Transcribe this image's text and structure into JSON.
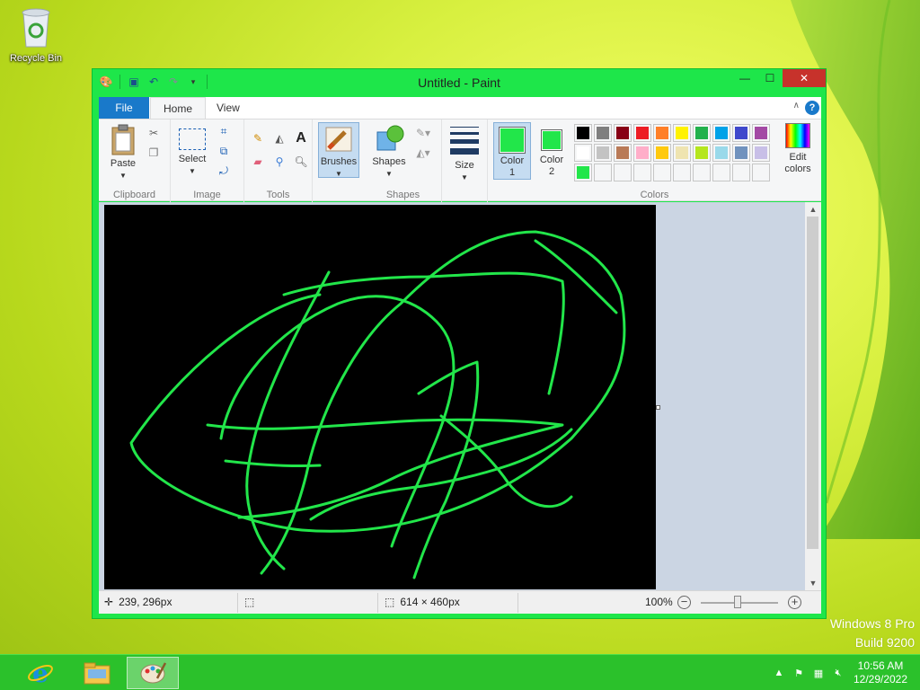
{
  "desktop": {
    "recycle_bin_label": "Recycle Bin",
    "watermark_line1": "Windows 8 Pro",
    "watermark_line2": "Build 9200"
  },
  "window": {
    "title": "Untitled - Paint",
    "controls": {
      "minimize": "—",
      "maximize": "☐",
      "close": "✕"
    }
  },
  "ribbon": {
    "tabs": {
      "file": "File",
      "home": "Home",
      "view": "View"
    },
    "help": "?",
    "groups": {
      "clipboard": {
        "label": "Clipboard",
        "paste": "Paste"
      },
      "image": {
        "label": "Image",
        "select": "Select"
      },
      "tools": {
        "label": "Tools"
      },
      "brushes": {
        "label": "Brushes"
      },
      "shapes": {
        "label": "Shapes",
        "shapes_btn": "Shapes"
      },
      "size": {
        "label": "Size"
      },
      "colors": {
        "label": "Colors",
        "color1_line1": "Color",
        "color1_line2": "1",
        "color2_line1": "Color",
        "color2_line2": "2",
        "color1_value": "#22e64a",
        "color2_value": "#22e64a",
        "edit_line1": "Edit",
        "edit_line2": "colors",
        "palette_row1": [
          "#000000",
          "#7f7f7f",
          "#880015",
          "#ed1c24",
          "#ff7f27",
          "#fff200",
          "#22b14c",
          "#00a2e8",
          "#3f48cc",
          "#a349a4"
        ],
        "palette_row2": [
          "#ffffff",
          "#c3c3c3",
          "#b97a57",
          "#ffaec9",
          "#ffc90e",
          "#efe4b0",
          "#b5e61d",
          "#99d9ea",
          "#7092be",
          "#c8bfe7"
        ],
        "palette_row3": [
          "#22e64a",
          "",
          "",
          "",
          "",
          "",
          "",
          "",
          "",
          ""
        ]
      }
    }
  },
  "status": {
    "cursor_pos": "239, 296px",
    "canvas_size": "614 × 460px",
    "zoom": "100%",
    "zoom_level": 1.0
  },
  "taskbar": {
    "time": "10:56 AM",
    "date": "12/29/2022"
  }
}
